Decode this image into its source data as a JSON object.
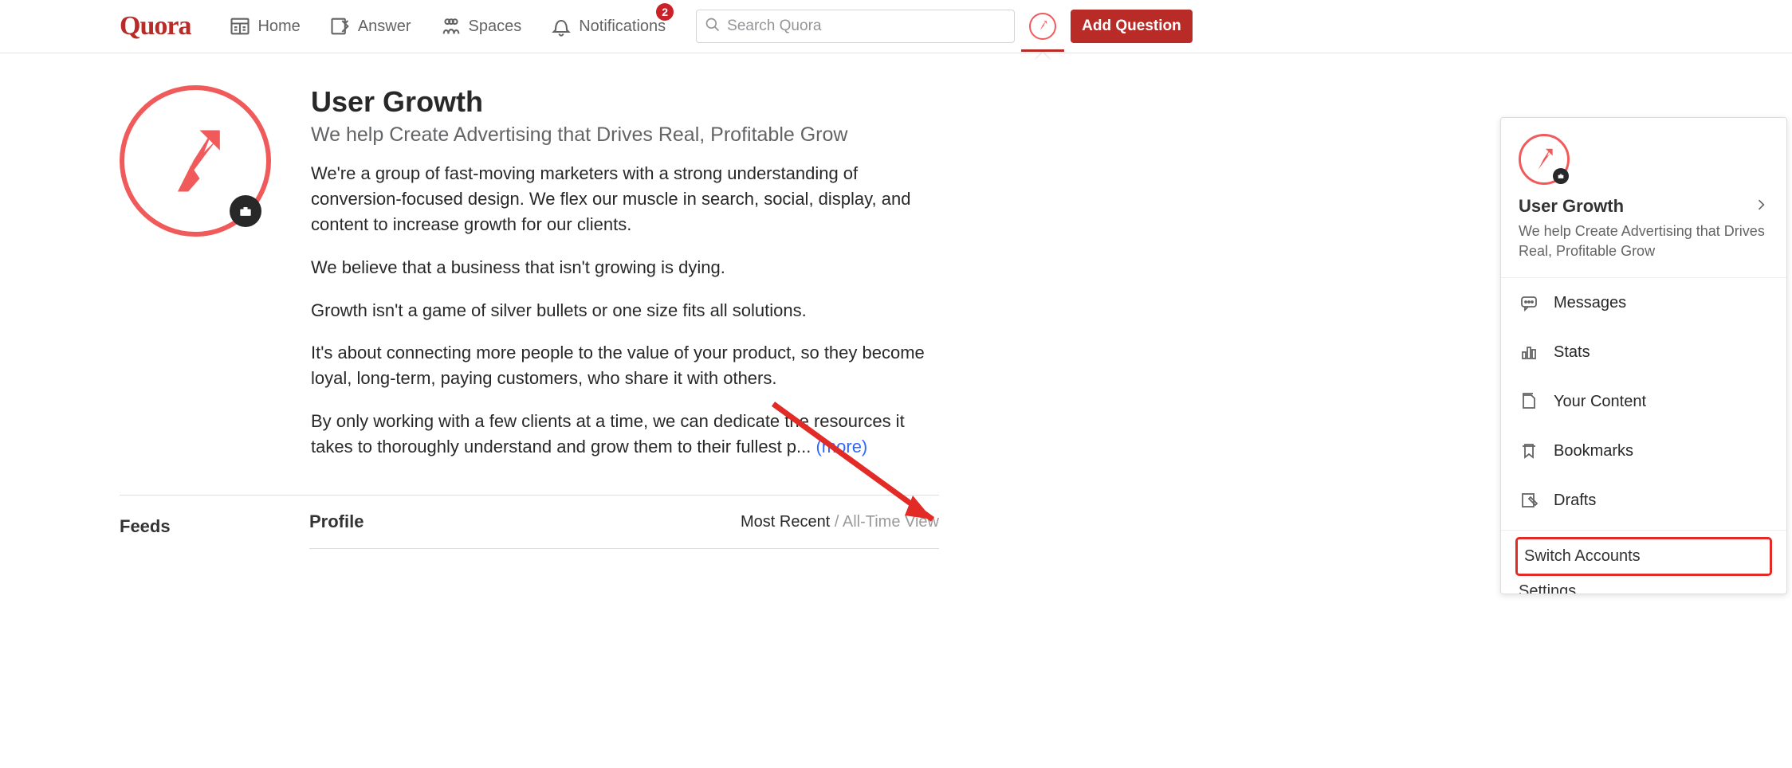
{
  "logo": "Quora",
  "nav": {
    "home": "Home",
    "answer": "Answer",
    "spaces": "Spaces",
    "notifications": "Notifications",
    "notif_badge": "2"
  },
  "search": {
    "placeholder": "Search Quora"
  },
  "add_question": "Add Question",
  "profile": {
    "title": "User Growth",
    "subtitle": "We help Create Advertising that Drives Real, Profitable Grow",
    "p1": "We're a group of fast-moving marketers with a strong understanding of conversion-focused design. We flex our muscle in search, social, display, and content to increase growth for our clients.",
    "p2": "We believe that a business that isn't growing is dying.",
    "p3": "Growth isn't a game of silver bullets or one size fits all solutions.",
    "p4": "It's about connecting more people to the value of your product, so they become loyal, long-term, paying customers, who share it with others.",
    "p5": "By only working with a few clients at a time, we can dedicate the resources it takes to thoroughly understand and grow them to their fullest p... ",
    "more": "(more)"
  },
  "bottom": {
    "feeds": "Feeds",
    "profile": "Profile",
    "sort_recent": "Most Recent",
    "sort_sep": " / ",
    "sort_all": "All-Time View"
  },
  "dropdown": {
    "name": "User Growth",
    "sub": "We help Create Advertising that Drives Real, Profitable Grow",
    "messages": "Messages",
    "stats": "Stats",
    "content": "Your Content",
    "bookmarks": "Bookmarks",
    "drafts": "Drafts",
    "switch": "Switch Accounts",
    "settings": "Settings"
  }
}
